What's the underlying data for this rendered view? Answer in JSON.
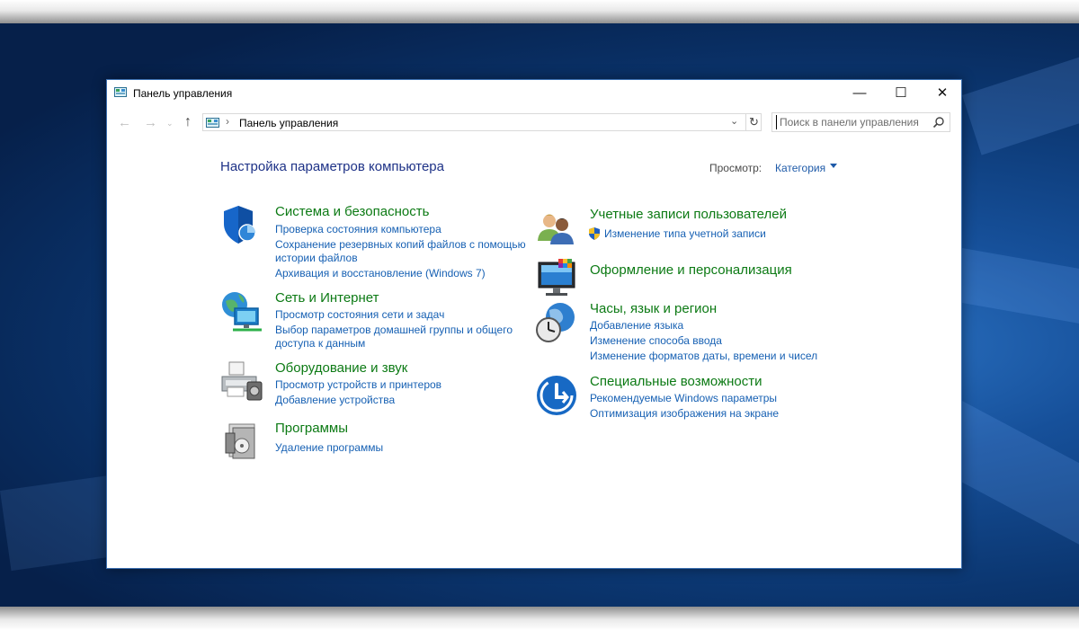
{
  "window": {
    "title": "Панель управления",
    "controls": {
      "minimize": "—",
      "maximize": "☐",
      "close": "✕"
    }
  },
  "nav": {
    "back": "←",
    "forward": "→",
    "recent": "⌄",
    "up": "↑",
    "address": "Панель управления",
    "address_sep": "›",
    "address_dropdown": "⌄",
    "refresh": "↻",
    "search_placeholder": "Поиск в панели управления"
  },
  "main": {
    "heading": "Настройка параметров компьютера",
    "view_label": "Просмотр:",
    "view_value": "Категория"
  },
  "categories_left": [
    {
      "icon": "shield-icon",
      "title": "Система и безопасность",
      "links": [
        "Проверка состояния компьютера",
        "Сохранение резервных копий файлов с помощью",
        "истории файлов",
        "Архивация и восстановление (Windows 7)"
      ]
    },
    {
      "icon": "network-globe-icon",
      "title": "Сеть и Интернет",
      "links": [
        "Просмотр состояния сети и задач",
        "Выбор параметров домашней группы и общего",
        "доступа к данным"
      ]
    },
    {
      "icon": "printer-icon",
      "title": "Оборудование и звук",
      "links": [
        "Просмотр устройств и принтеров",
        "Добавление устройства"
      ]
    },
    {
      "icon": "programs-disc-icon",
      "title": "Программы",
      "links": [
        "Удаление программы"
      ]
    }
  ],
  "categories_right": [
    {
      "icon": "users-icon",
      "title": "Учетные записи пользователей",
      "links": [
        "Изменение типа учетной записи"
      ]
    },
    {
      "icon": "monitor-palette-icon",
      "title": "Оформление и персонализация",
      "links": []
    },
    {
      "icon": "globe-clock-icon",
      "title": "Часы, язык и регион",
      "links": [
        "Добавление языка",
        "Изменение способа ввода",
        "Изменение форматов даты, времени и чисел"
      ]
    },
    {
      "icon": "accessibility-icon",
      "title": "Специальные возможности",
      "links": [
        "Рекомендуемые Windows параметры",
        "Оптимизация изображения на экране"
      ]
    }
  ],
  "colors": {
    "category_title": "#0c7a14",
    "link": "#1660b3",
    "heading": "#1e3287",
    "window_border": "#3b6fb0"
  }
}
